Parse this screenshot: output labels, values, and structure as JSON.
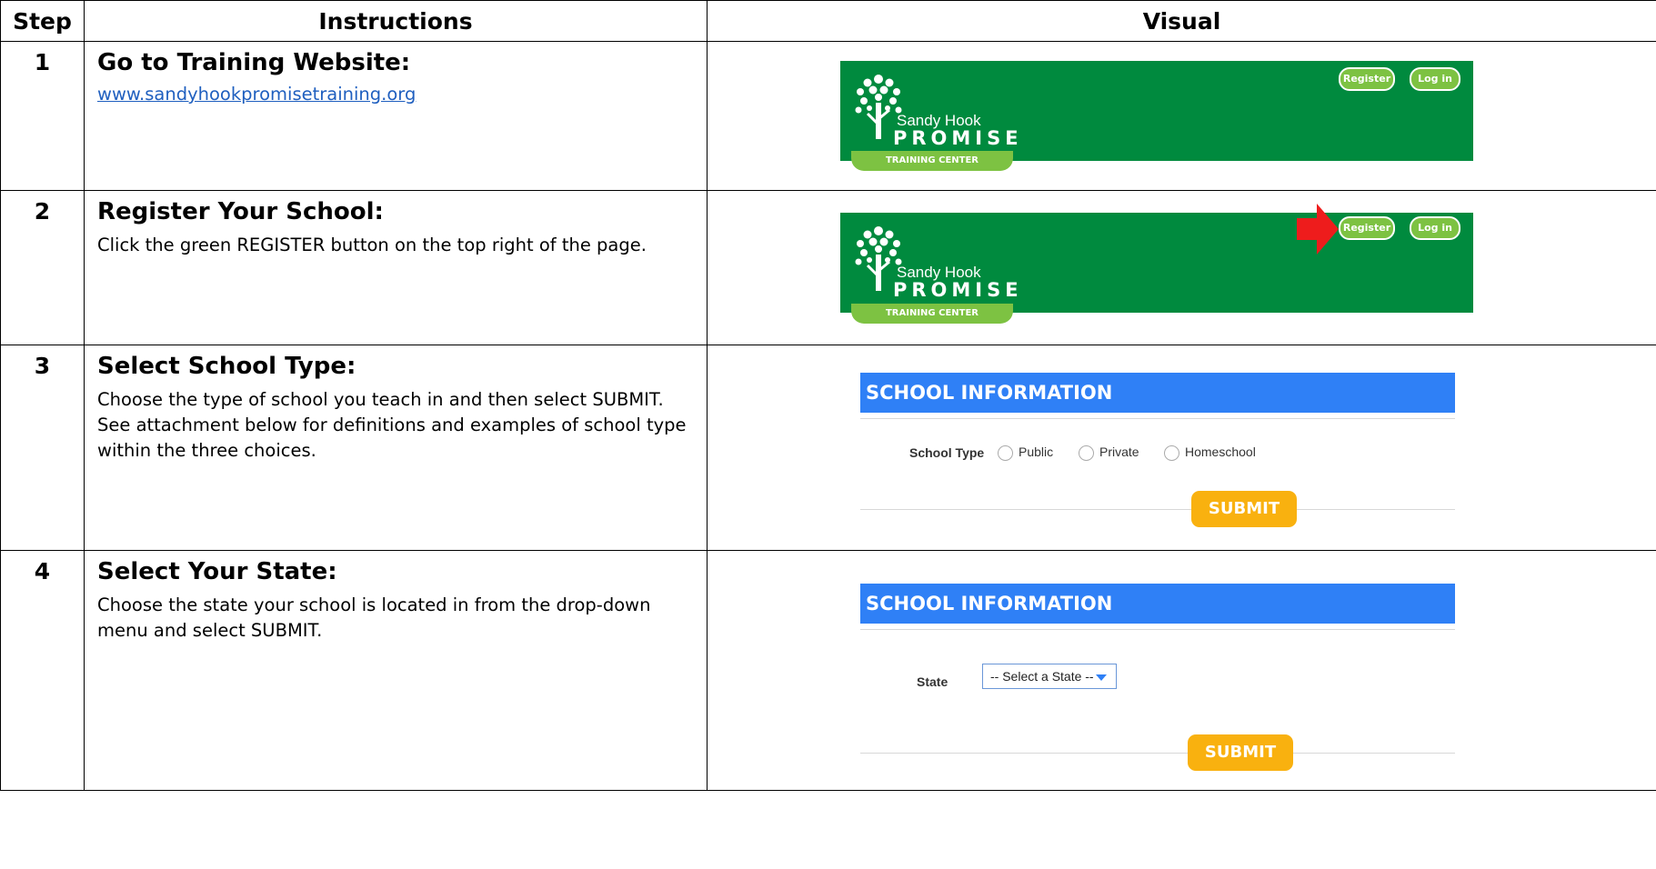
{
  "headers": {
    "step": "Step",
    "instructions": "Instructions",
    "visual": "Visual"
  },
  "brand": {
    "name_line1": "Sandy Hook",
    "name_line2": "PROMISE",
    "tab": "TRAINING CENTER",
    "register": "Register",
    "login": "Log in",
    "header_color": "#008a3e",
    "accent_green": "#7dc242"
  },
  "steps": [
    {
      "number": "1",
      "title": "Go to Training Website:",
      "link": "www.sandyhookpromisetraining.org"
    },
    {
      "number": "2",
      "title": "Register Your School:",
      "text": "Click the green REGISTER button on the top right of the page."
    },
    {
      "number": "3",
      "title": "Select School Type:",
      "text": "Choose the type of school you teach in and then select SUBMIT. See attachment below for definitions and examples of school type within the three choices."
    },
    {
      "number": "4",
      "title": "Select Your State:",
      "text": "Choose the state your school is located in from the drop-down menu and select SUBMIT."
    }
  ],
  "school_form": {
    "heading": "SCHOOL INFORMATION",
    "school_type_label": "School Type",
    "options": [
      "Public",
      "Private",
      "Homeschool"
    ],
    "state_label": "State",
    "state_selected": "-- Select a State --",
    "submit": "SUBMIT",
    "bar_color": "#2f80f6",
    "submit_color": "#f9b10f"
  },
  "icons": {
    "arrow": "red-arrow-icon",
    "tree": "tree-logo-icon"
  }
}
